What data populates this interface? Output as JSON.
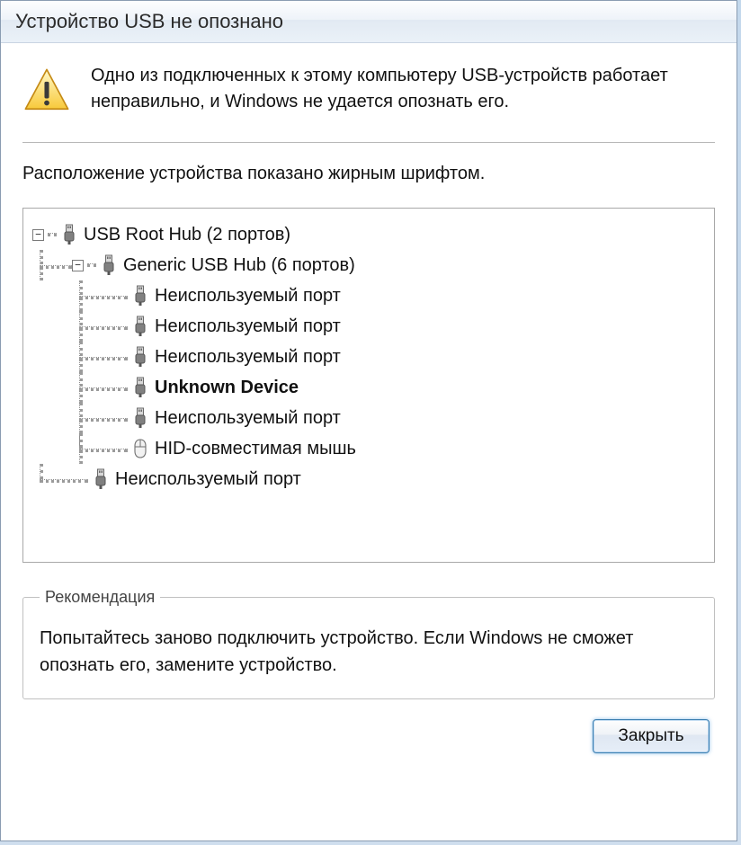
{
  "window": {
    "title": "Устройство USB не опознано"
  },
  "message": "Одно из подключенных к этому компьютеру USB-устройств работает неправильно, и Windows не удается опознать его.",
  "location_caption": "Расположение устройства показано жирным шрифтом.",
  "tree": {
    "root": {
      "label": "USB Root Hub (2 портов)",
      "icon": "usb-plug-icon",
      "children": [
        {
          "label": "Generic USB Hub (6 портов)",
          "icon": "usb-plug-icon",
          "children": [
            {
              "label": "Неиспользуемый порт",
              "icon": "usb-plug-icon"
            },
            {
              "label": "Неиспользуемый порт",
              "icon": "usb-plug-icon"
            },
            {
              "label": "Неиспользуемый порт",
              "icon": "usb-plug-icon"
            },
            {
              "label": "Unknown Device",
              "icon": "usb-plug-icon",
              "bold": true
            },
            {
              "label": "Неиспользуемый порт",
              "icon": "usb-plug-icon"
            },
            {
              "label": "HID-совместимая мышь",
              "icon": "mouse-icon"
            }
          ]
        },
        {
          "label": "Неиспользуемый порт",
          "icon": "usb-plug-icon"
        }
      ]
    }
  },
  "recommendation": {
    "legend": "Рекомендация",
    "body": "Попытайтесь заново подключить устройство. Если Windows не сможет опознать его, замените устройство."
  },
  "buttons": {
    "close": "Закрыть"
  }
}
